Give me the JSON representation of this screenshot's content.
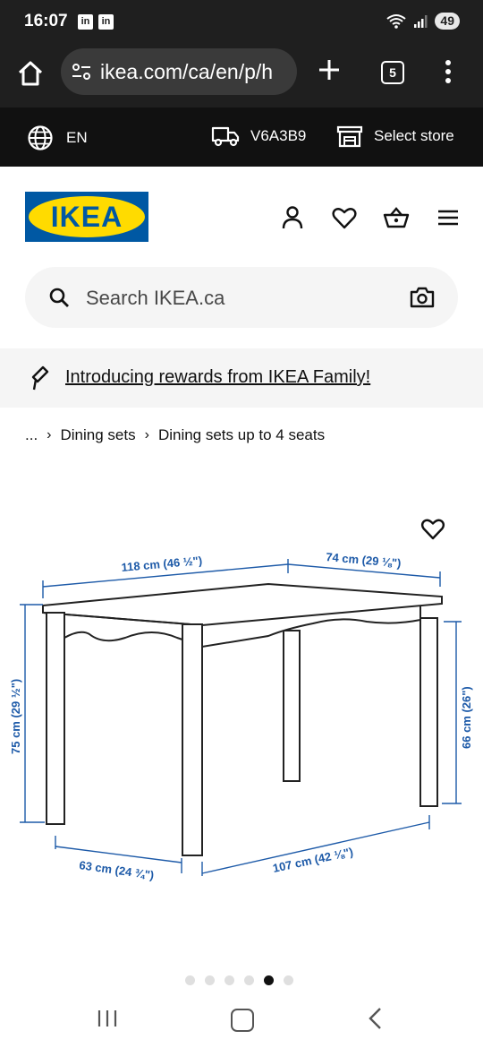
{
  "status_bar": {
    "time": "16:07",
    "notif_icons": [
      "linkedin-icon",
      "linkedin-icon"
    ],
    "battery": "49"
  },
  "browser": {
    "url": "ikea.com/ca/en/p/h",
    "tab_count": "5"
  },
  "ikea_topbar": {
    "language": "EN",
    "postal_code": "V6A3B9",
    "store_label": "Select store"
  },
  "header": {
    "logo_text": "IKEA",
    "icons": [
      "user-icon",
      "heart-icon",
      "basket-icon",
      "menu-icon"
    ]
  },
  "search": {
    "placeholder": "Search IKEA.ca"
  },
  "promo": {
    "text": "Introducing rewards from IKEA Family!"
  },
  "breadcrumb": {
    "ellipsis": "...",
    "items": [
      "Dining sets",
      "Dining sets up to 4 seats"
    ]
  },
  "product_image": {
    "dimensions": {
      "top_length": "118 cm (46 ½\")",
      "top_width": "74 cm (29 ⅛\")",
      "height_total": "75 cm (29 ½\")",
      "height_under": "66 cm (26\")",
      "bottom_width": "63 cm (24 ¾\")",
      "bottom_length": "107 cm (42 ⅛\")"
    }
  },
  "carousel": {
    "count": 6,
    "active_index": 4
  },
  "colors": {
    "ikea_blue": "#0058a3",
    "ikea_yellow": "#ffdb00",
    "dimension_blue": "#1d5aa8",
    "dark_bar": "#111111"
  }
}
